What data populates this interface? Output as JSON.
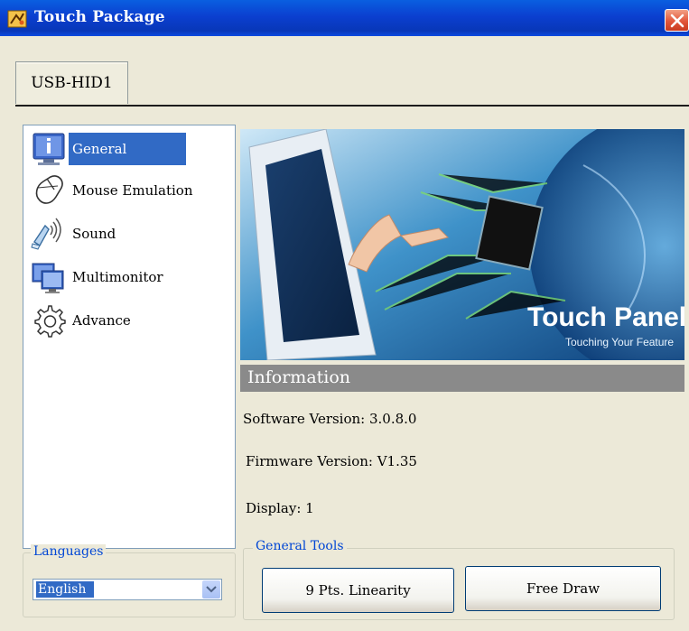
{
  "window": {
    "title": "Touch Package"
  },
  "tabs": [
    {
      "label": "USB-HID1",
      "selected": true
    }
  ],
  "nav": {
    "items": [
      {
        "label": "General",
        "icon": "info-icon",
        "selected": true
      },
      {
        "label": "Mouse Emulation",
        "icon": "mouse-icon",
        "selected": false
      },
      {
        "label": "Sound",
        "icon": "speaker-icon",
        "selected": false
      },
      {
        "label": "Multimonitor",
        "icon": "monitors-icon",
        "selected": false
      },
      {
        "label": "Advance",
        "icon": "gear-icon",
        "selected": false
      }
    ]
  },
  "languages": {
    "legend": "Languages",
    "selected": "English"
  },
  "banner": {
    "title": "Touch Panel",
    "tagline": "Touching Your Feature"
  },
  "information": {
    "title": "Information",
    "software_version": "Software Version: 3.0.8.0",
    "firmware_version": "Firmware Version: V1.35",
    "display": "Display: 1"
  },
  "tools": {
    "legend": "General Tools",
    "linearity_label": "9 Pts. Linearity",
    "free_draw_label": "Free Draw"
  },
  "colors": {
    "titlebar": "#0b3fd0",
    "selection": "#316ac5",
    "group_legend": "#0046d5",
    "info_bar": "#8a8a8a"
  }
}
